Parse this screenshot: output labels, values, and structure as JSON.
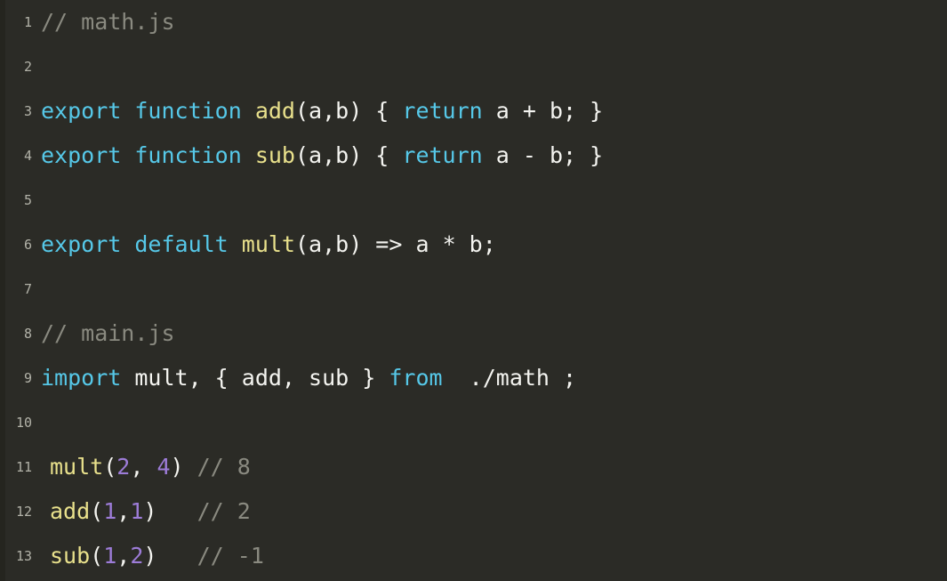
{
  "editor": {
    "background_color": "#2b2b26",
    "gutter_color": "#b2b2a8",
    "font_size_px": 25,
    "line_height_px": 50,
    "total_lines": 13,
    "theme_colors": {
      "comment": "#8a8a80",
      "keyword": "#56c8e8",
      "function": "#e9e18c",
      "number": "#9d7cd8",
      "plain": "#f4f4f0"
    }
  },
  "lines": [
    {
      "number": "1",
      "indent": 0,
      "tokens": [
        {
          "text": "// math.js",
          "type": "comment"
        }
      ]
    },
    {
      "number": "2",
      "indent": 0,
      "tokens": []
    },
    {
      "number": "3",
      "indent": 0,
      "tokens": [
        {
          "text": "export function ",
          "type": "keyword"
        },
        {
          "text": "add",
          "type": "function"
        },
        {
          "text": "(a,b) { ",
          "type": "plain"
        },
        {
          "text": "return",
          "type": "keyword"
        },
        {
          "text": " a + b; }",
          "type": "plain"
        }
      ]
    },
    {
      "number": "4",
      "indent": 0,
      "tokens": [
        {
          "text": "export function ",
          "type": "keyword"
        },
        {
          "text": "sub",
          "type": "function"
        },
        {
          "text": "(a,b) { ",
          "type": "plain"
        },
        {
          "text": "return",
          "type": "keyword"
        },
        {
          "text": " a - b; }",
          "type": "plain"
        }
      ]
    },
    {
      "number": "5",
      "indent": 0,
      "tokens": []
    },
    {
      "number": "6",
      "indent": 0,
      "tokens": [
        {
          "text": "export default ",
          "type": "keyword"
        },
        {
          "text": "mult",
          "type": "function"
        },
        {
          "text": "(a,b) => a * b;",
          "type": "plain"
        }
      ]
    },
    {
      "number": "7",
      "indent": 0,
      "tokens": []
    },
    {
      "number": "8",
      "indent": 0,
      "tokens": [
        {
          "text": "// main.js",
          "type": "comment"
        }
      ]
    },
    {
      "number": "9",
      "indent": 0,
      "tokens": [
        {
          "text": "import",
          "type": "keyword"
        },
        {
          "text": " mult, { add, sub } ",
          "type": "plain"
        },
        {
          "text": "from",
          "type": "keyword"
        },
        {
          "text": "  ./math ;",
          "type": "string"
        }
      ]
    },
    {
      "number": "10",
      "indent": 0,
      "tokens": []
    },
    {
      "number": "11",
      "indent": 10,
      "tokens": [
        {
          "text": "mult",
          "type": "function"
        },
        {
          "text": "(",
          "type": "plain"
        },
        {
          "text": "2",
          "type": "number"
        },
        {
          "text": ", ",
          "type": "plain"
        },
        {
          "text": "4",
          "type": "number"
        },
        {
          "text": ") ",
          "type": "plain"
        },
        {
          "text": "// 8",
          "type": "comment"
        }
      ]
    },
    {
      "number": "12",
      "indent": 10,
      "tokens": [
        {
          "text": "add",
          "type": "function"
        },
        {
          "text": "(",
          "type": "plain"
        },
        {
          "text": "1",
          "type": "number"
        },
        {
          "text": ",",
          "type": "plain"
        },
        {
          "text": "1",
          "type": "number"
        },
        {
          "text": ")   ",
          "type": "plain"
        },
        {
          "text": "// 2",
          "type": "comment"
        }
      ]
    },
    {
      "number": "13",
      "indent": 10,
      "tokens": [
        {
          "text": "sub",
          "type": "function"
        },
        {
          "text": "(",
          "type": "plain"
        },
        {
          "text": "1",
          "type": "number"
        },
        {
          "text": ",",
          "type": "plain"
        },
        {
          "text": "2",
          "type": "number"
        },
        {
          "text": ")   ",
          "type": "plain"
        },
        {
          "text": "// -1",
          "type": "comment"
        }
      ]
    }
  ]
}
